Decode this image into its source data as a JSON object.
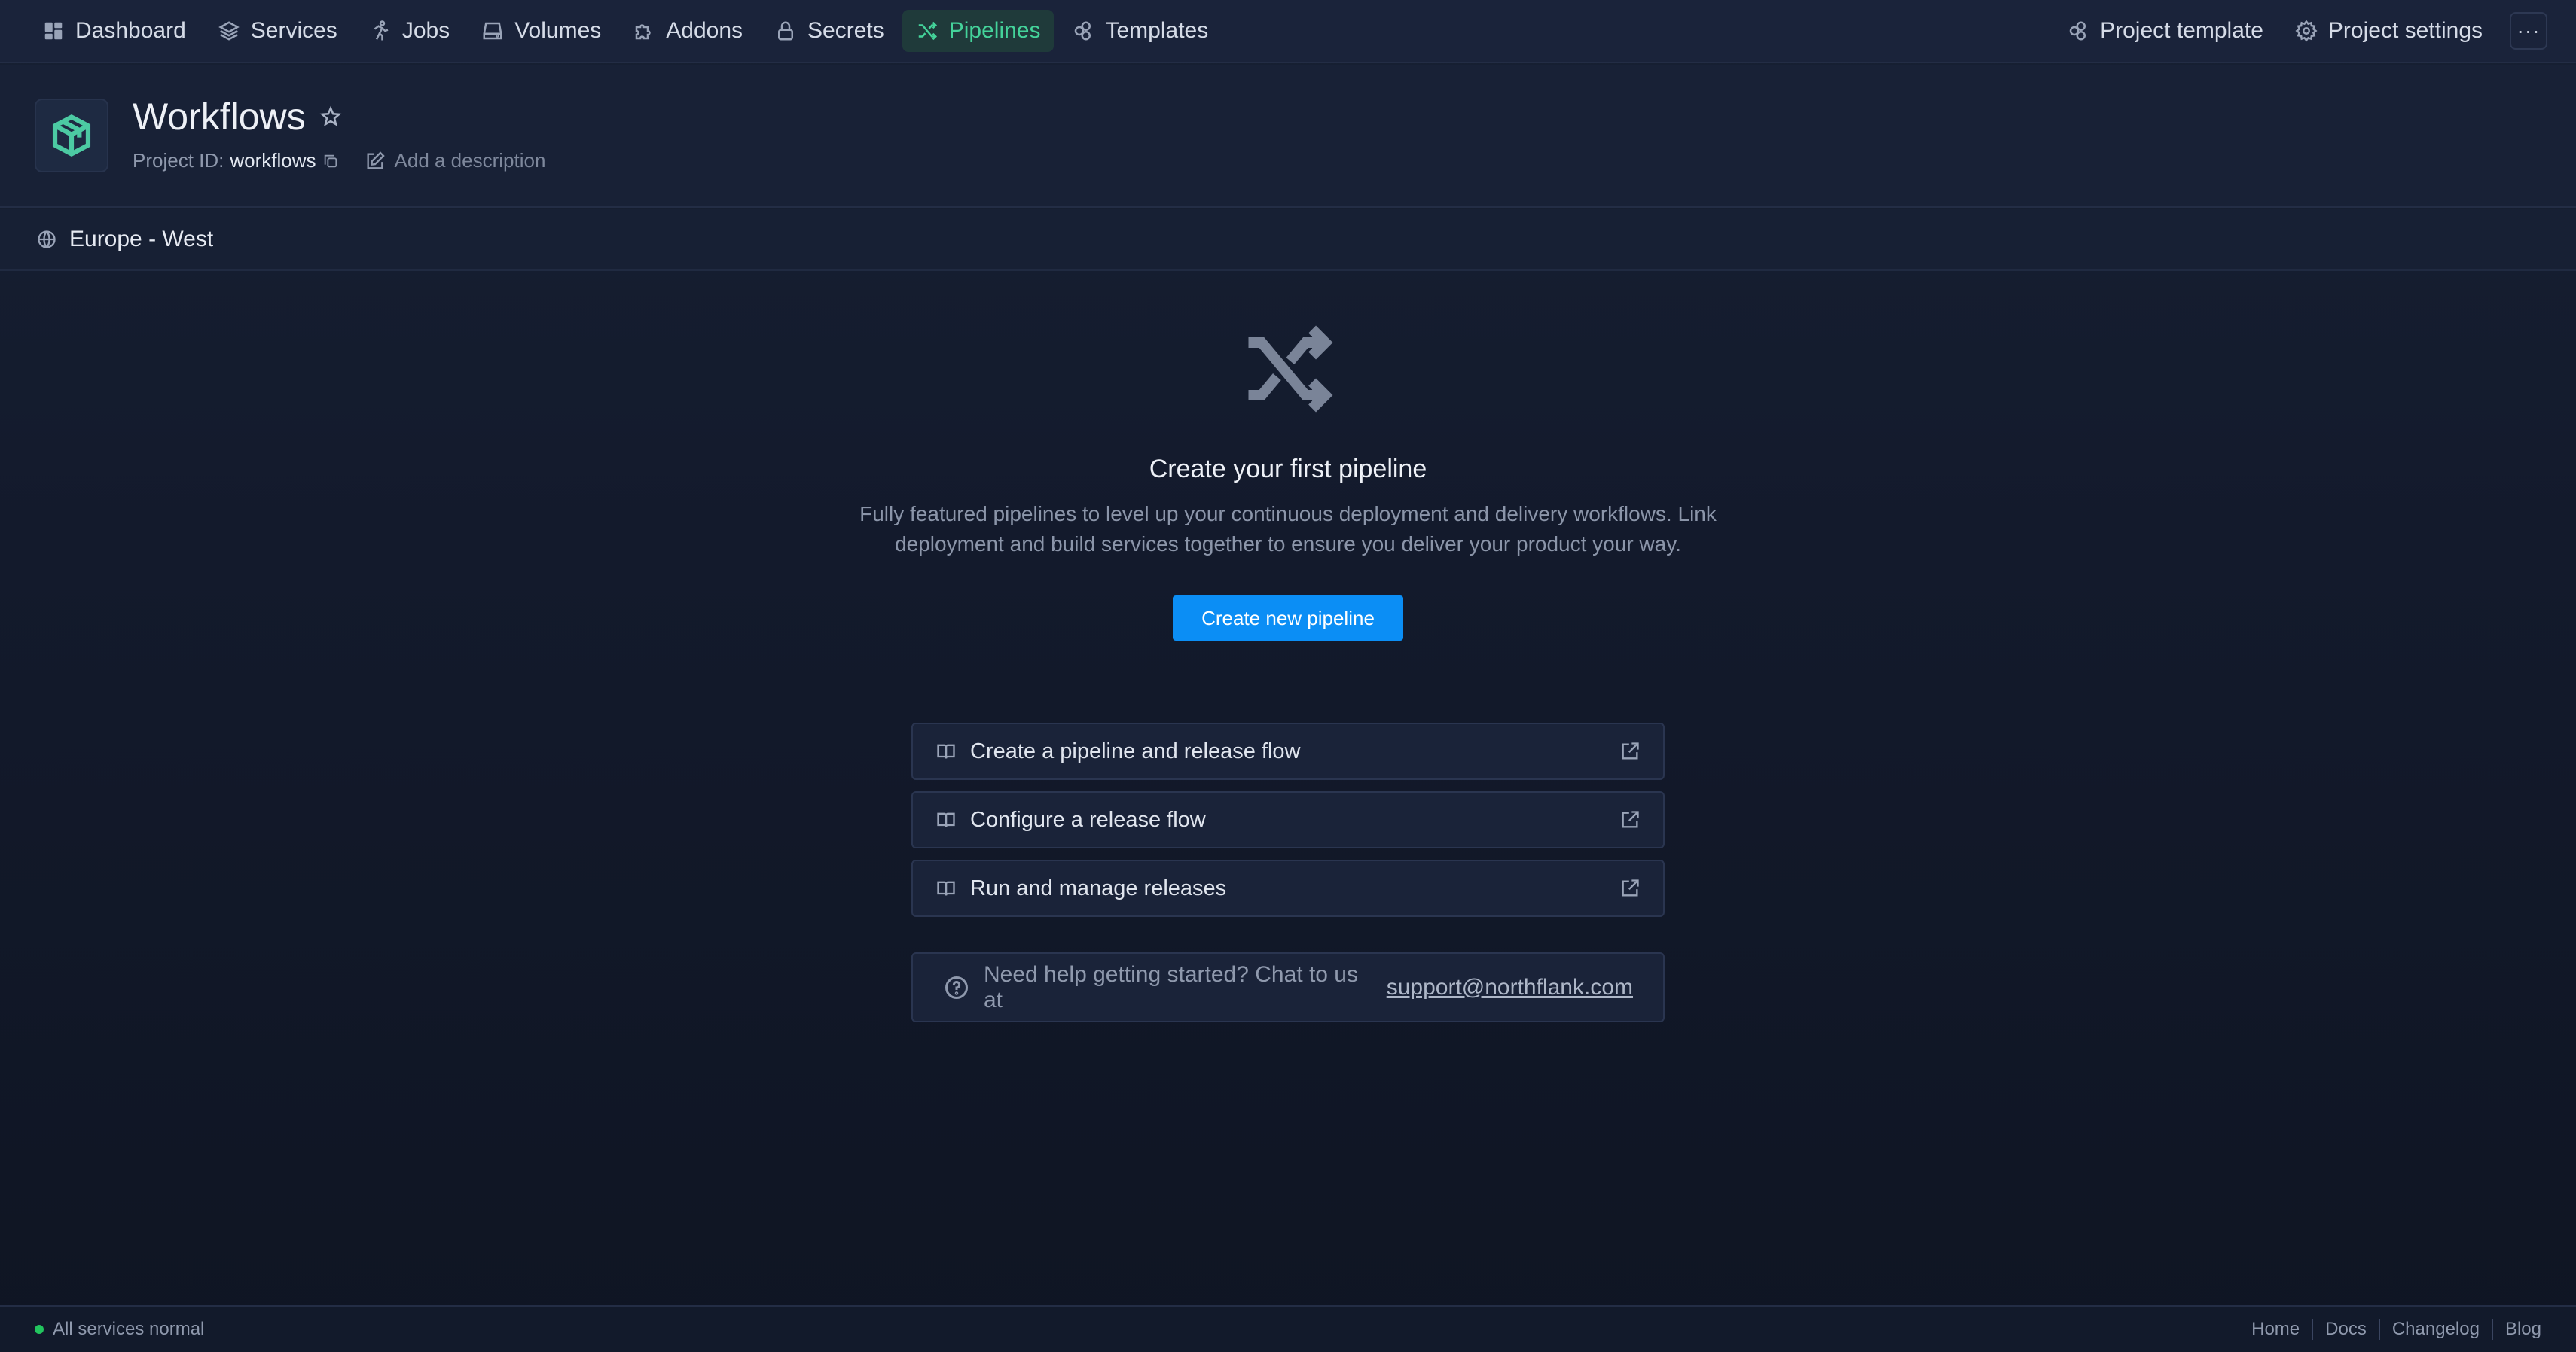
{
  "nav": {
    "items": [
      {
        "label": "Dashboard",
        "icon": "dashboard-icon"
      },
      {
        "label": "Services",
        "icon": "layers-icon"
      },
      {
        "label": "Jobs",
        "icon": "runner-icon"
      },
      {
        "label": "Volumes",
        "icon": "drive-icon"
      },
      {
        "label": "Addons",
        "icon": "puzzle-icon"
      },
      {
        "label": "Secrets",
        "icon": "lock-icon"
      },
      {
        "label": "Pipelines",
        "icon": "shuffle-icon",
        "active": true
      },
      {
        "label": "Templates",
        "icon": "template-icon"
      }
    ],
    "right": [
      {
        "label": "Project template",
        "icon": "template-icon"
      },
      {
        "label": "Project settings",
        "icon": "gear-icon"
      }
    ],
    "more_label": "···"
  },
  "project": {
    "title": "Workflows",
    "id_label": "Project ID:",
    "id_value": "workflows",
    "description_placeholder": "Add a description"
  },
  "region": {
    "name": "Europe - West"
  },
  "empty_state": {
    "title": "Create your first pipeline",
    "description": "Fully featured pipelines to level up your continuous deployment and delivery workflows. Link deployment and build services together to ensure you deliver your product your way.",
    "button_label": "Create new pipeline"
  },
  "doc_links": [
    {
      "label": "Create a pipeline and release flow"
    },
    {
      "label": "Configure a release flow"
    },
    {
      "label": "Run and manage releases"
    }
  ],
  "help": {
    "text": "Need help getting started? Chat to us at",
    "email": "support@northflank.com"
  },
  "footer": {
    "status": "All services normal",
    "status_color": "#22c55e",
    "links": [
      "Home",
      "Docs",
      "Changelog",
      "Blog"
    ]
  },
  "colors": {
    "accent": "#0b8ef5",
    "active_nav": "#44d39a"
  }
}
